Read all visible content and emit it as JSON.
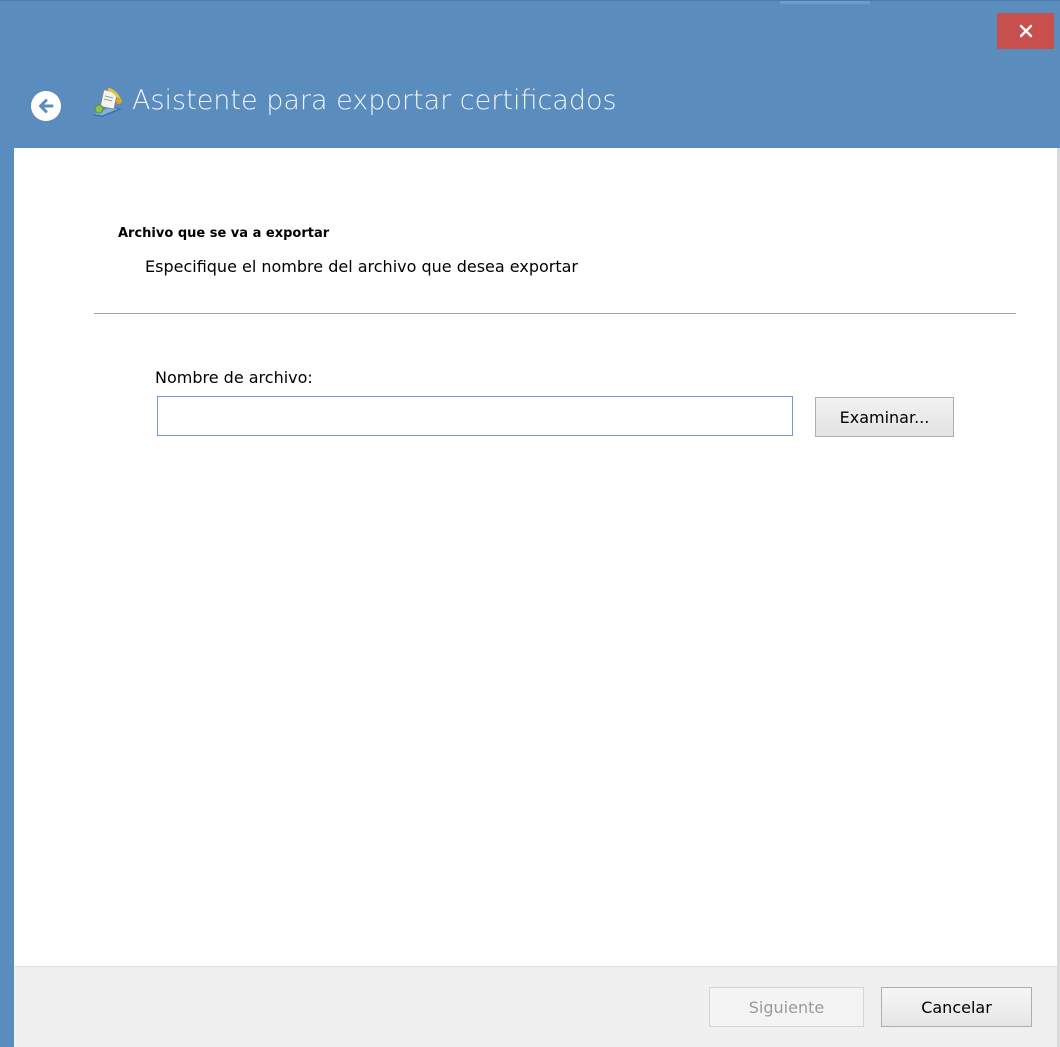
{
  "window": {
    "title": "Asistente para exportar certificados",
    "titlebar_color": "#5a8cbd",
    "close_color": "#c7504e"
  },
  "icons": {
    "close": "close-icon",
    "back": "back-arrow-icon",
    "wizard": "certificate-wizard-icon"
  },
  "page": {
    "section_title": "Archivo que se va a exportar",
    "section_description": "Especifique el nombre del archivo que desea exportar",
    "filename_label": "Nombre de archivo:",
    "filename_value": "",
    "browse_label": "Examinar..."
  },
  "footer": {
    "next_label": "Siguiente",
    "next_enabled": false,
    "cancel_label": "Cancelar"
  }
}
